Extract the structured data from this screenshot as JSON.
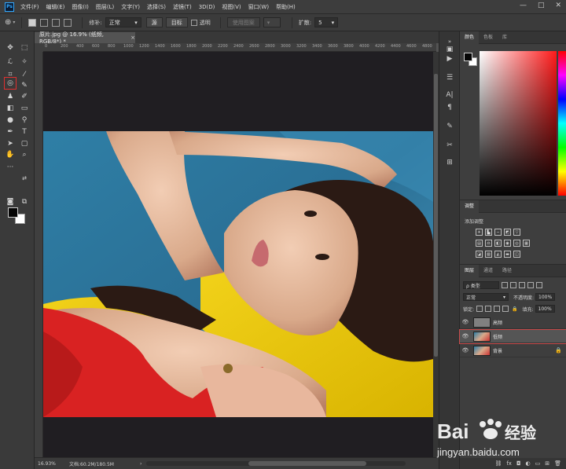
{
  "app": {
    "logo": "Ps",
    "menus": [
      "文件(F)",
      "编辑(E)",
      "图像(I)",
      "图层(L)",
      "文字(Y)",
      "选择(S)",
      "滤镜(T)",
      "3D(D)",
      "视图(V)",
      "窗口(W)",
      "帮助(H)"
    ],
    "window_controls": {
      "minimize": "—",
      "maximize": "□",
      "close": "✕"
    }
  },
  "options": {
    "source_label": "修补:",
    "mode_value": "正常",
    "source_button": "源",
    "target_button": "目标",
    "transparent_label": "透明",
    "use_pattern_button": "使用图案",
    "diffusion_label": "扩散:",
    "diffusion_value": "5"
  },
  "document": {
    "tab_title": "原片.jpg @ 16.9% (纸频, RGB/8*) *",
    "tab_close": "×",
    "ruler_ticks": [
      "0",
      "200",
      "400",
      "600",
      "800",
      "1000",
      "1200",
      "1400",
      "1600",
      "1800",
      "2000",
      "2200",
      "2400",
      "2600",
      "2800",
      "3000",
      "3200",
      "3400",
      "3600",
      "3800",
      "4000",
      "4200",
      "4400",
      "4600",
      "4800"
    ]
  },
  "status": {
    "zoom": "16.93%",
    "doc_size": "文档:60.2M/180.5M",
    "arrow": "›"
  },
  "color_panel": {
    "tabs": [
      "颜色",
      "色板",
      "库"
    ]
  },
  "adjust_panel": {
    "tabs": [
      "调整"
    ],
    "title": "添加调整"
  },
  "layers_panel": {
    "tabs": [
      "图层",
      "通道",
      "路径"
    ],
    "filter_label": "ρ 类型",
    "blend_mode": "正常",
    "opacity_label": "不透明度:",
    "opacity_value": "100%",
    "lock_label": "锁定:",
    "fill_label": "填充:",
    "fill_value": "100%",
    "layers": [
      {
        "name": "高频",
        "visible": true,
        "selected": false,
        "locked": false
      },
      {
        "name": "低频",
        "visible": true,
        "selected": true,
        "locked": false
      },
      {
        "name": "背景",
        "visible": true,
        "selected": false,
        "locked": true
      }
    ],
    "footer_icons": [
      "link-icon",
      "fx-icon",
      "mask-icon",
      "adjustment-icon",
      "group-icon",
      "new-layer-icon",
      "trash-icon"
    ]
  },
  "watermark": {
    "brand": "Bai",
    "brand_cn": "经验",
    "url": "jingyan.baidu.com"
  },
  "colors": {
    "accent": "#31a8ff",
    "selected_outline": "#c94a4a",
    "canvas_bg": "#201e22"
  }
}
